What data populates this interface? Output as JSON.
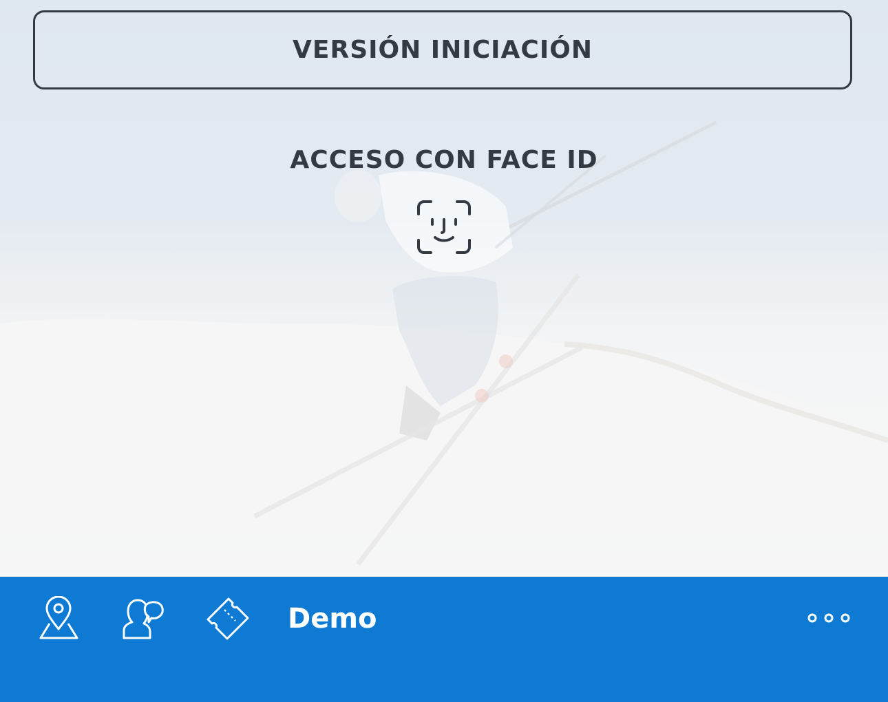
{
  "header": {
    "version_label": "VERSIÓN INICIACIÓN"
  },
  "login": {
    "faceid_title": "ACCESO CON FACE ID",
    "faceid_icon": "face-id-icon"
  },
  "bottom_nav": {
    "icons": [
      "map-pin-icon",
      "users-chat-icon",
      "ticket-icon",
      "more-icon"
    ],
    "demo_label": "Demo",
    "background_color": "#0f7ad3"
  },
  "colors": {
    "text_dark": "#343a44",
    "accent_blue": "#0f7ad3"
  }
}
